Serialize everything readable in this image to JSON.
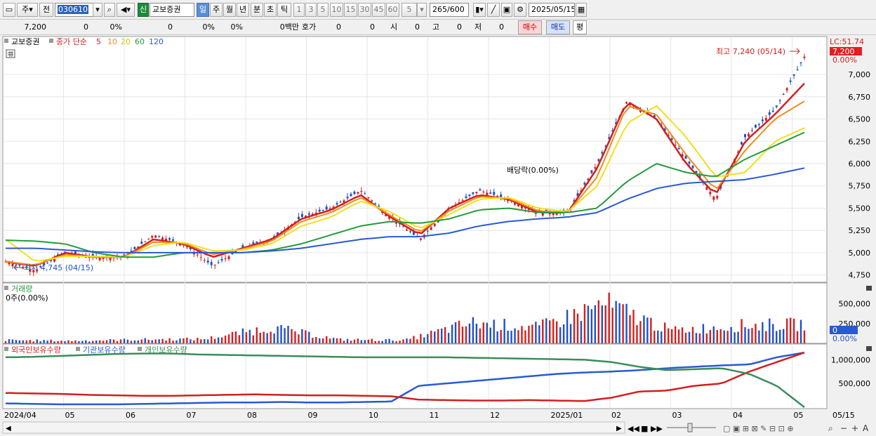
{
  "toolbar": {
    "period_short": "주",
    "prev_label": "전",
    "code": "030610",
    "stock_name": "교보증권",
    "shin": "신",
    "periods": [
      "일",
      "주",
      "월",
      "년",
      "분",
      "초",
      "틱"
    ],
    "minutes": [
      "1",
      "3",
      "5",
      "10",
      "15",
      "30",
      "45",
      "60"
    ],
    "n_select": "5",
    "count": "265",
    "count_max": "/600",
    "date": "2025/05/15"
  },
  "quote": {
    "price": "7,200",
    "change": "0",
    "change_pct": "0%",
    "volume": "0",
    "vol_pct": "0%",
    "pct2": "0%",
    "amount": "0백만",
    "hoga_label": "호가",
    "hoga_1": "0",
    "hoga_2": "0",
    "open_label": "시",
    "open": "0",
    "high_label": "고",
    "high": "0",
    "low_label": "저",
    "low": "0",
    "buy": "매수",
    "sell": "매도",
    "avg": "평"
  },
  "legend": {
    "name": "교보증권",
    "ma_label": "종가 단순",
    "ma5": "5",
    "ma10": "10",
    "ma20": "20",
    "ma60": "60",
    "ma120": "120",
    "volume_title": "거래량",
    "volume_value": "0주(0.00%)",
    "holdings": [
      "외국인보유수량",
      "기관보유수량",
      "개인보유수량"
    ]
  },
  "price_axis": {
    "lc_label": "LC:51.74",
    "current": "7,200",
    "current_pct": "0.00%",
    "ticks": [
      "7,000",
      "6,750",
      "6,500",
      "6,250",
      "6,000",
      "5,750",
      "5,500",
      "5,250",
      "5,000",
      "4,750"
    ]
  },
  "volume_axis": {
    "ticks": [
      "500,000",
      "250,000"
    ],
    "current": "0",
    "current_pct": "0.00%"
  },
  "holdings_axis": {
    "ticks": [
      "1,000,000",
      "500,000"
    ]
  },
  "date_axis": [
    "2024/04",
    "05",
    "06",
    "07",
    "08",
    "09",
    "10",
    "11",
    "12",
    "2025/01",
    "02",
    "03",
    "04",
    "05",
    "05/15"
  ],
  "annotations": {
    "high": "최고 7,240 (05/14)",
    "low": "최저 4,745 (04/15)",
    "dividend": "배당락(0.00%)"
  },
  "colors": {
    "up": "#d21f1f",
    "down": "#1f50c8",
    "ma5": "#d21f1f",
    "ma10": "#f08c1e",
    "ma20": "#f0e01e",
    "ma60": "#239b3c",
    "ma120": "#2a5ad2",
    "foreign": "#2a5ad2",
    "institution": "#d21f1f",
    "individual": "#3c8c5a"
  },
  "chart_data": {
    "type": "candlestick",
    "period": "daily",
    "x_range": [
      "2024/04",
      "2025/05/15"
    ],
    "price_ylim": [
      4700,
      7300
    ],
    "price_series": [
      {
        "date": "2024/04",
        "close": 4900
      },
      {
        "date": "2024/04/15",
        "close": 4800
      },
      {
        "date": "2024/05",
        "close": 5000
      },
      {
        "date": "2024/06",
        "close": 4950
      },
      {
        "date": "2024/07",
        "close": 4950
      },
      {
        "date": "2024/07/20",
        "close": 5200
      },
      {
        "date": "2024/08",
        "close": 5100
      },
      {
        "date": "2024/08/05",
        "close": 4850
      },
      {
        "date": "2024/08/20",
        "close": 5050
      },
      {
        "date": "2024/09",
        "close": 5150
      },
      {
        "date": "2024/09/20",
        "close": 5400
      },
      {
        "date": "2024/10",
        "close": 5500
      },
      {
        "date": "2024/10/20",
        "close": 5700
      },
      {
        "date": "2024/11",
        "close": 5400
      },
      {
        "date": "2024/11/20",
        "close": 5150
      },
      {
        "date": "2024/12",
        "close": 5500
      },
      {
        "date": "2024/12/20",
        "close": 5700
      },
      {
        "date": "2025/01",
        "close": 5600
      },
      {
        "date": "2025/01/20",
        "close": 5450
      },
      {
        "date": "2025/02",
        "close": 5450
      },
      {
        "date": "2025/02/20",
        "close": 6000
      },
      {
        "date": "2025/03",
        "close": 6700
      },
      {
        "date": "2025/03/15",
        "close": 6500
      },
      {
        "date": "2025/04",
        "close": 6050
      },
      {
        "date": "2025/04/10",
        "close": 5600
      },
      {
        "date": "2025/04/25",
        "close": 6300
      },
      {
        "date": "2025/05/05",
        "close": 6600
      },
      {
        "date": "2025/05/15",
        "close": 7200
      }
    ],
    "moving_averages": [
      {
        "name": "5",
        "values": [
          4900,
          4850,
          5000,
          4950,
          4950,
          5150,
          5100,
          4950,
          5050,
          5150,
          5380,
          5480,
          5650,
          5400,
          5200,
          5500,
          5650,
          5600,
          5450,
          5450,
          5950,
          6700,
          6500,
          6000,
          5650,
          6250,
          6550,
          6900
        ]
      },
      {
        "name": "10",
        "values": [
          4900,
          4860,
          4980,
          4950,
          4950,
          5120,
          5110,
          4980,
          5040,
          5130,
          5350,
          5450,
          5620,
          5420,
          5230,
          5470,
          5630,
          5610,
          5470,
          5450,
          5850,
          6650,
          6550,
          6100,
          5700,
          6150,
          6500,
          6700
        ]
      },
      {
        "name": "20",
        "values": [
          5150,
          4900,
          4960,
          4960,
          4950,
          5080,
          5120,
          5020,
          5030,
          5100,
          5300,
          5400,
          5580,
          5460,
          5270,
          5430,
          5600,
          5620,
          5500,
          5460,
          5750,
          6450,
          6650,
          6300,
          5850,
          5900,
          6250,
          6400
        ]
      },
      {
        "name": "60",
        "values": [
          5140,
          5130,
          5100,
          5000,
          4950,
          4950,
          5000,
          5000,
          5000,
          5030,
          5100,
          5200,
          5300,
          5350,
          5330,
          5380,
          5480,
          5500,
          5450,
          5450,
          5500,
          5800,
          6000,
          5900,
          5850,
          6050,
          6200,
          6350
        ]
      },
      {
        "name": "120",
        "values": [
          5050,
          5050,
          5030,
          5010,
          5000,
          5000,
          5000,
          5000,
          5000,
          5020,
          5050,
          5100,
          5150,
          5180,
          5180,
          5220,
          5300,
          5350,
          5380,
          5400,
          5450,
          5600,
          5720,
          5780,
          5800,
          5820,
          5880,
          5950
        ]
      }
    ],
    "volume_series": [
      {
        "date": "2024/04",
        "value": 50000
      },
      {
        "date": "2024/06",
        "value": 40000
      },
      {
        "date": "2024/08",
        "value": 60000
      },
      {
        "date": "2024/09",
        "value": 70000
      },
      {
        "date": "2024/10",
        "value": 250000
      },
      {
        "date": "2024/11",
        "value": 60000
      },
      {
        "date": "2025/01",
        "value": 50000
      },
      {
        "date": "2025/02",
        "value": 320000
      },
      {
        "date": "2025/03",
        "value": 250000
      },
      {
        "date": "2025/04",
        "value": 620000
      },
      {
        "date": "2025/04/20",
        "value": 200000
      },
      {
        "date": "2025/05/10",
        "value": 280000
      },
      {
        "date": "2025/05/14",
        "value": 300000
      }
    ],
    "volume_ylim": [
      0,
      700000
    ],
    "holdings_ylim": [
      0,
      1300000
    ],
    "holdings": [
      {
        "name": "외국인보유수량",
        "values": [
          80000,
          70000,
          60000,
          60000,
          60000,
          70000,
          80000,
          90000,
          100000,
          100000,
          110000,
          100000,
          100000,
          110000,
          120000,
          450000,
          500000,
          550000,
          600000,
          650000,
          700000,
          730000,
          750000,
          780000,
          820000,
          850000,
          880000,
          900000,
          1050000,
          1150000
        ]
      },
      {
        "name": "기관보유수량",
        "values": [
          300000,
          290000,
          280000,
          260000,
          250000,
          240000,
          240000,
          250000,
          260000,
          270000,
          260000,
          250000,
          250000,
          240000,
          230000,
          160000,
          150000,
          140000,
          140000,
          150000,
          140000,
          130000,
          200000,
          330000,
          350000,
          450000,
          500000,
          750000,
          950000,
          1150000
        ]
      },
      {
        "name": "개인보유수량",
        "values": [
          1050000,
          1060000,
          1080000,
          1100000,
          1120000,
          1130000,
          1130000,
          1110000,
          1100000,
          1090000,
          1080000,
          1070000,
          1060000,
          1050000,
          1050000,
          1050000,
          1050000,
          1040000,
          1030000,
          1020000,
          1010000,
          1000000,
          950000,
          850000,
          780000,
          800000,
          820000,
          700000,
          450000,
          0
        ]
      }
    ]
  }
}
